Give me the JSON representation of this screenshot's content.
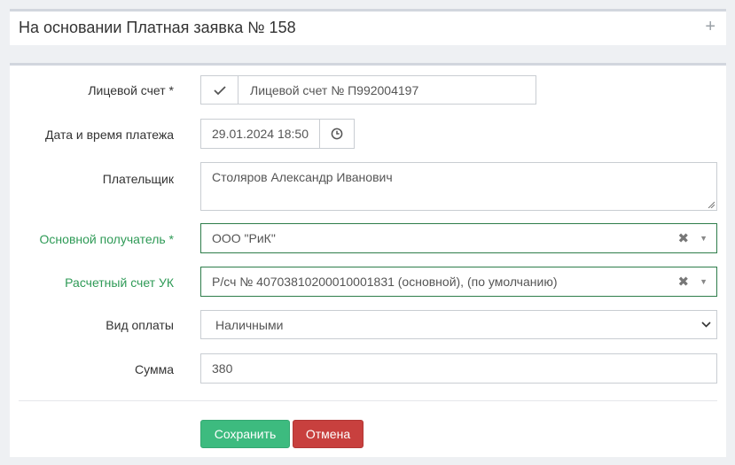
{
  "header": {
    "title": "На основании Платная заявка № 158",
    "expand_icon": "plus-icon"
  },
  "form": {
    "account": {
      "label": "Лицевой счет *",
      "value": "Лицевой счет № П992004197",
      "icon": "check-icon"
    },
    "datetime": {
      "label": "Дата и время платежа",
      "value": "29.01.2024 18:50",
      "icon": "clock-icon"
    },
    "payer": {
      "label": "Плательщик",
      "value": "Столяров Александр Иванович"
    },
    "recipient": {
      "label": "Основной получатель *",
      "value": "ООО \"РиК\""
    },
    "bank_account": {
      "label": "Расчетный счет УК",
      "value": "Р/сч № 40703810200010001831 (основной), (по умолчанию)"
    },
    "payment_type": {
      "label": "Вид оплаты",
      "value": "Наличными"
    },
    "amount": {
      "label": "Сумма",
      "value": "380"
    }
  },
  "actions": {
    "save_label": "Сохранить",
    "cancel_label": "Отмена"
  },
  "colors": {
    "accent_green": "#2e9a56",
    "save": "#3dbb7f",
    "cancel": "#c8403e"
  }
}
